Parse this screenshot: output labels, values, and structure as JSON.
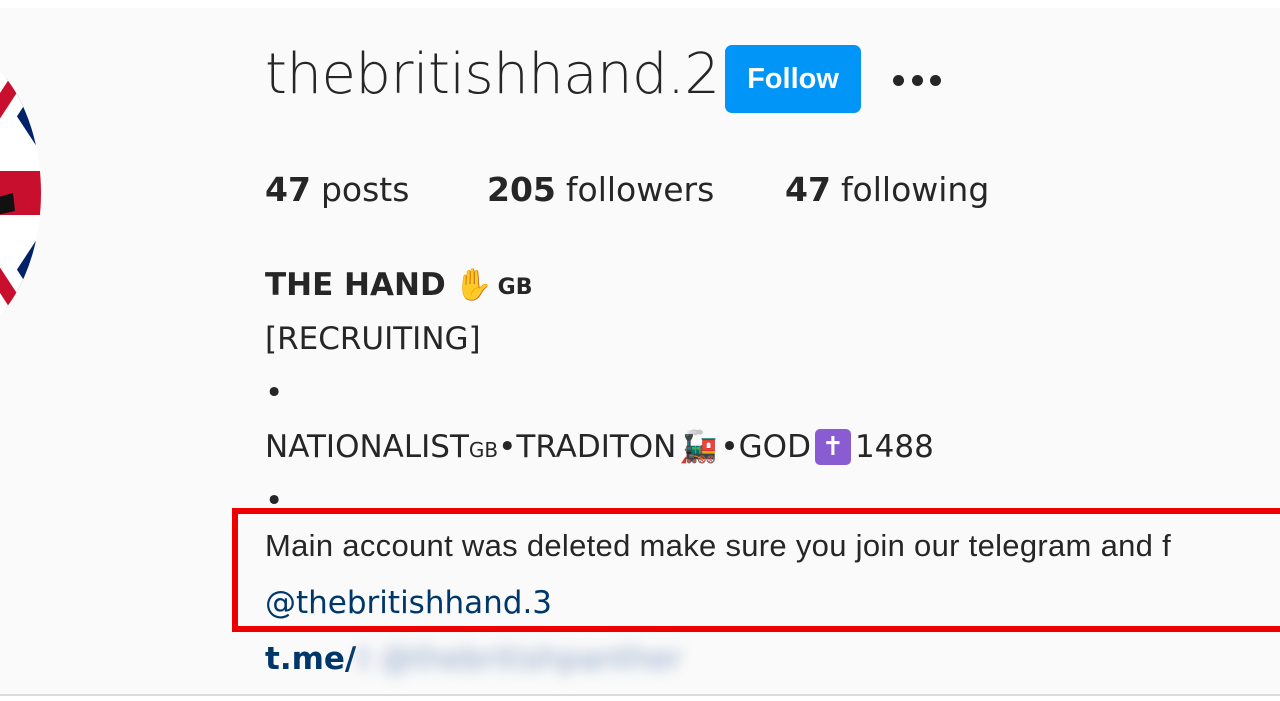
{
  "profile": {
    "username": "thebritishhand.2",
    "follow_label": "Follow",
    "more_icon": "more-horizontal-icon"
  },
  "stats": {
    "posts_count": "47",
    "posts_label": "posts",
    "followers_count": "205",
    "followers_label": "followers",
    "following_count": "47",
    "following_label": "following"
  },
  "bio": {
    "full_name": "THE HAND",
    "hand_emoji": "✋",
    "flag_code": "GB",
    "line_recruiting": "[RECRUITING]",
    "bullet": "•",
    "nationalist": "NATIONALIST",
    "flag_code_2": "GB",
    "traditon": "•TRADITON",
    "train_emoji": "🚂",
    "god": "•GOD",
    "cross": "✝",
    "number": "1488",
    "main_text": "Main account was deleted make sure you join our telegram and f",
    "mention": "@thebritishhand.3",
    "link_prefix": "t.me/",
    "link_blurred": "t @thebritishpanther"
  },
  "colors": {
    "follow_bg": "#0095f6",
    "highlight": "#ee0000",
    "link": "#00376b"
  }
}
